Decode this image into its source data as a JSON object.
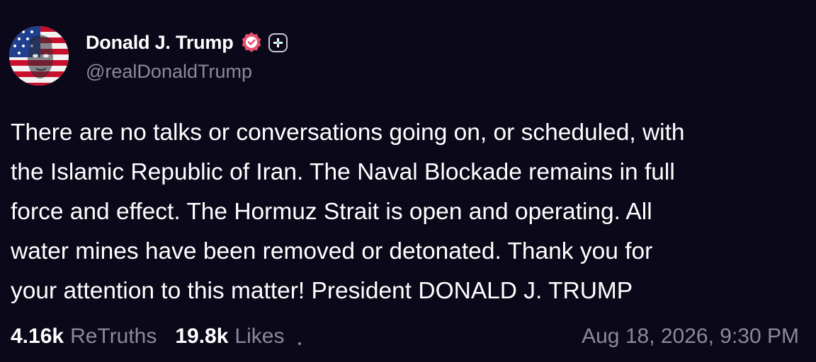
{
  "author": {
    "display_name": "Donald J. Trump",
    "handle": "@realDonaldTrump",
    "avatar_icon": "avatar-flag-portrait",
    "verified_icon": "verified-badge-icon",
    "verified_color": "#e8506b",
    "plus_icon": "plus-icon"
  },
  "post": {
    "lines": [
      "There are no talks or conversations going on, or scheduled, with",
      "the Islamic Republic of Iran. The Naval Blockade remains in full",
      "force and effect. The Hormuz Strait is open and operating. All",
      "water mines have been removed or detonated. Thank you for",
      "your attention to this matter! President DONALD J. TRUMP"
    ]
  },
  "stats": {
    "retruths_count": "4.16k",
    "retruths_label": "ReTruths",
    "likes_count": "19.8k",
    "likes_label": "Likes"
  },
  "timestamp": "Aug 18, 2026, 9:30 PM",
  "colors": {
    "background": "#0b0819",
    "text_primary": "#ffffff",
    "text_secondary": "#8b8a98"
  }
}
